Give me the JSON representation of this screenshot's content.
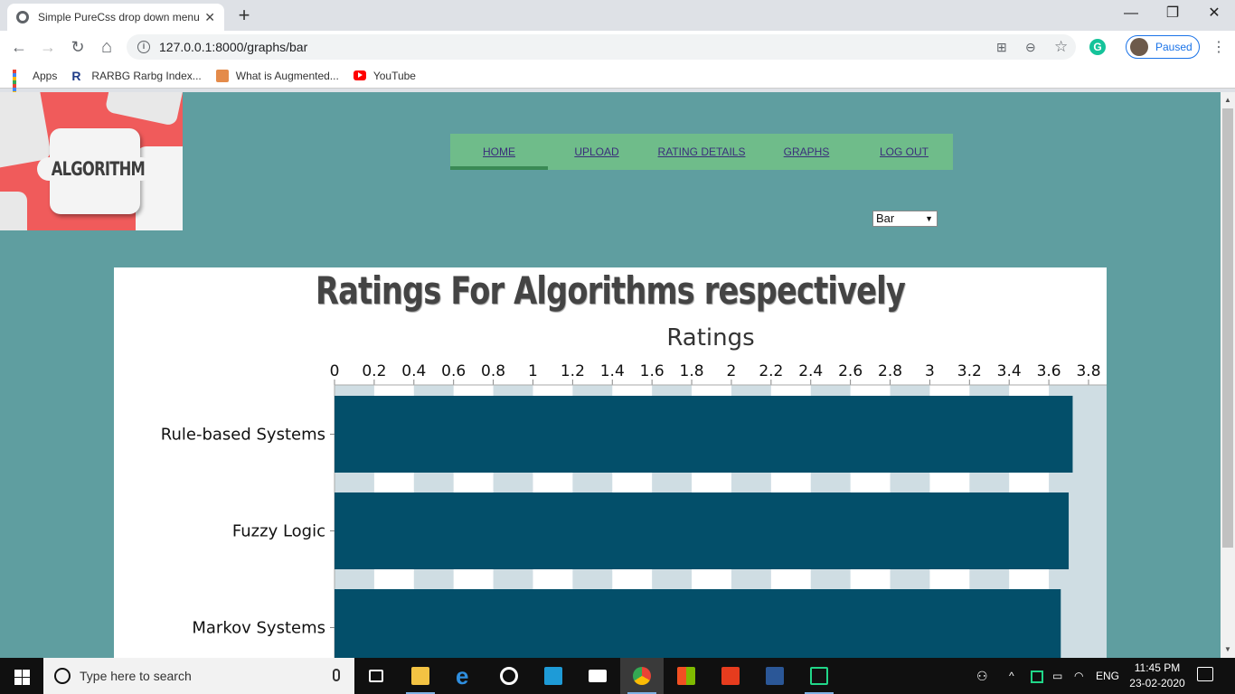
{
  "browser": {
    "tab_title": "Simple PureCss drop down menu",
    "tab_close": "✕",
    "new_tab": "+",
    "url": "127.0.0.1:8000/graphs/bar",
    "profile_label": "Paused",
    "extension_letter": "G",
    "window_controls": {
      "minimize": "—",
      "maximize": "❐",
      "close": "✕"
    },
    "nav_glyphs": {
      "back": "←",
      "forward": "→",
      "reload": "↻",
      "home": "⌂",
      "translate": "⊞",
      "zoom": "⊖",
      "star": "☆",
      "menu": "⋮"
    }
  },
  "bookmarks": [
    {
      "label": "Apps",
      "icon": "apps-grid-icon"
    },
    {
      "label": "RARBG Rarbg Index...",
      "icon": "rarbg-icon"
    },
    {
      "label": "What is Augmented...",
      "icon": "augmented-icon"
    },
    {
      "label": "YouTube",
      "icon": "youtube-icon"
    }
  ],
  "page": {
    "logo_text": "ALGORITHM",
    "nav": [
      {
        "label": "HOME",
        "active": true
      },
      {
        "label": "UPLOAD",
        "active": false
      },
      {
        "label": "RATING DETAILS",
        "active": false
      },
      {
        "label": "GRAPHS",
        "active": false
      },
      {
        "label": "LOG OUT",
        "active": false
      }
    ],
    "graph_type_select": {
      "value": "Bar",
      "caret": "▼"
    }
  },
  "chart_data": {
    "type": "bar",
    "orientation": "horizontal",
    "title": "Ratings For Algorithms respectively",
    "xlabel": "Ratings",
    "xlim": [
      0,
      3.8
    ],
    "x_ticks": [
      "0",
      "0.2",
      "0.4",
      "0.6",
      "0.8",
      "1",
      "1.2",
      "1.4",
      "1.6",
      "1.8",
      "2",
      "2.2",
      "2.4",
      "2.6",
      "2.8",
      "3",
      "3.2",
      "3.4",
      "3.6",
      "3.8"
    ],
    "x_axis_position": "top",
    "categories": [
      "Rule-based Systems",
      "Fuzzy Logic",
      "Markov Systems"
    ],
    "values": [
      3.72,
      3.7,
      3.66
    ],
    "colors": {
      "bar": "#034f6a",
      "band": "#cfdde3",
      "background": "#ffffff"
    },
    "grid": true
  },
  "taskbar": {
    "search_placeholder": "Type here to search",
    "apps": [
      "task-view-icon",
      "file-explorer-icon",
      "edge-icon",
      "groove-music-icon",
      "lens-app-icon",
      "mail-icon",
      "chrome-icon",
      "store-icon",
      "office-icon",
      "word-icon",
      "pycharm-icon"
    ],
    "tray_lang": "ENG",
    "time": "11:45 PM",
    "date": "23-02-2020"
  }
}
